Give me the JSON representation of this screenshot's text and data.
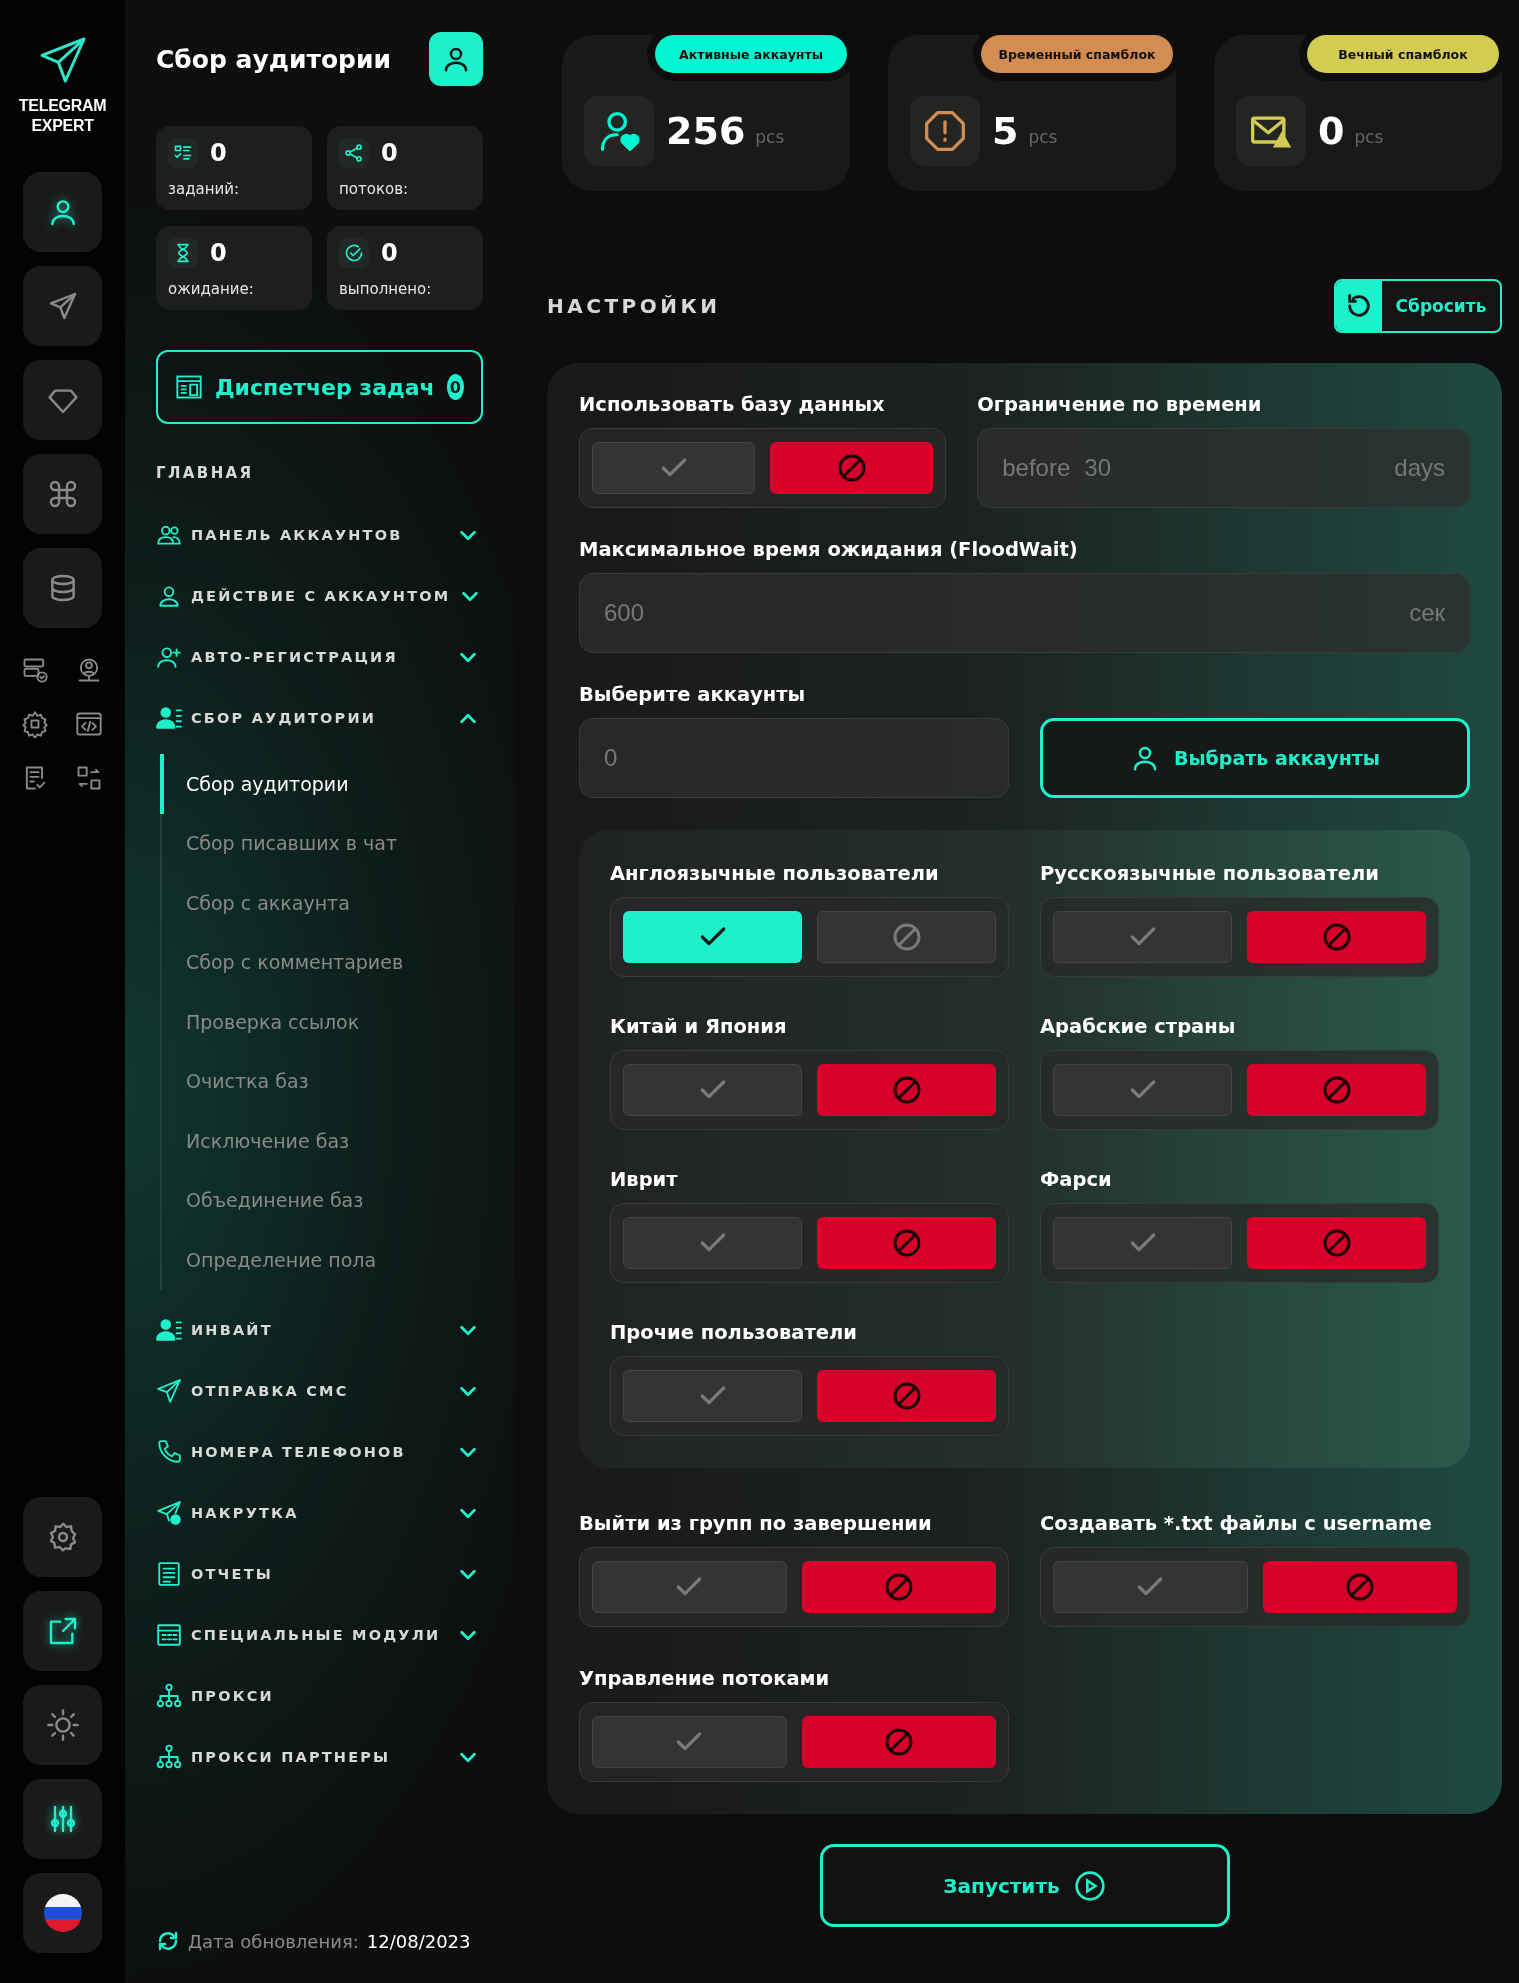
{
  "rail": {
    "logo": [
      "TELEGRAM",
      "EXPERT"
    ],
    "top_buttons": [
      {
        "selected": true
      },
      {
        "selected": false
      },
      {
        "selected": false
      },
      {
        "selected": false
      },
      {
        "selected": false
      }
    ],
    "bottom_buttons": [
      {
        "highlighted": false
      },
      {
        "highlighted": true
      },
      {
        "highlighted": false
      },
      {
        "highlighted": true
      }
    ]
  },
  "sidebar": {
    "title": "Сбор аудитории",
    "stats": [
      {
        "value": "0",
        "label": "заданий:"
      },
      {
        "value": "0",
        "label": "потоков:"
      },
      {
        "value": "0",
        "label": "ожидание:"
      },
      {
        "value": "0",
        "label": "выполнено:"
      }
    ],
    "task_manager": {
      "label": "Диспетчер задач",
      "count": "0"
    },
    "section": "ГЛАВНАЯ",
    "menu": [
      {
        "label": "ПАНЕЛЬ АККАУНТОВ",
        "kind": "group",
        "expanded": false
      },
      {
        "label": "ДЕЙСТВИЕ С АККАУНТОМ",
        "kind": "group",
        "expanded": false
      },
      {
        "label": "АВТО-РЕГИСТРАЦИЯ",
        "kind": "group",
        "expanded": false
      },
      {
        "label": "СБОР АУДИТОРИИ",
        "kind": "group",
        "expanded": true,
        "children": [
          {
            "label": "Сбор аудитории",
            "selected": true
          },
          {
            "label": "Сбор писавших в чат",
            "selected": false
          },
          {
            "label": "Сбор с аккаунта",
            "selected": false
          },
          {
            "label": "Сбор с комментариев",
            "selected": false
          },
          {
            "label": "Проверка ссылок",
            "selected": false
          },
          {
            "label": "Очистка баз",
            "selected": false
          },
          {
            "label": "Исключение баз",
            "selected": false
          },
          {
            "label": "Объединение баз",
            "selected": false
          },
          {
            "label": "Определение пола",
            "selected": false
          }
        ]
      },
      {
        "label": "ИНВАЙТ",
        "kind": "group",
        "expanded": false
      },
      {
        "label": "ОТПРАВКА СМС",
        "kind": "group",
        "expanded": false
      },
      {
        "label": "НОМЕРА ТЕЛЕФОНОВ",
        "kind": "group",
        "expanded": false
      },
      {
        "label": "НАКРУТКА",
        "kind": "group",
        "expanded": false
      },
      {
        "label": "ОТЧЕТЫ",
        "kind": "group",
        "expanded": false
      },
      {
        "label": "СПЕЦИАЛЬНЫЕ МОДУЛИ",
        "kind": "group",
        "expanded": false
      },
      {
        "label": "ПРОКСИ",
        "kind": "link"
      },
      {
        "label": "ПРОКСИ ПАРТНЕРЫ",
        "kind": "group",
        "expanded": false
      }
    ],
    "footer": {
      "label": "Дата обновления:",
      "date": "12/08/2023"
    }
  },
  "stats": [
    {
      "badge": "Активные аккаунты",
      "value": "256",
      "unit": "pcs",
      "color": "#00f5d0"
    },
    {
      "badge": "Временный спамблок",
      "value": "5",
      "unit": "pcs",
      "color": "#d38c52"
    },
    {
      "badge": "Вечный спамблок",
      "value": "0",
      "unit": "pcs",
      "color": "#d3cc52"
    }
  ],
  "settings": {
    "title": "НАСТРОЙКИ",
    "reset": "Сбросить",
    "use_database": {
      "label": "Использовать базу данных",
      "enabled": false
    },
    "time_limit": {
      "label": "Ограничение по времени",
      "prefix": "before",
      "placeholder": "30",
      "unit": "days"
    },
    "flood_wait": {
      "label": "Максимальное время ожидания (FloodWait)",
      "placeholder": "600",
      "unit": "сек"
    },
    "accounts": {
      "label": "Выберите аккаунты",
      "placeholder": "0",
      "button": "Выбрать аккаунты"
    },
    "languages": [
      {
        "label": "Англоязычные пользователи",
        "enabled": true
      },
      {
        "label": "Русскоязычные пользователи",
        "enabled": false
      },
      {
        "label": "Китай и Япония",
        "enabled": false
      },
      {
        "label": "Арабские страны",
        "enabled": false
      },
      {
        "label": "Иврит",
        "enabled": false
      },
      {
        "label": "Фарси",
        "enabled": false
      },
      {
        "label": "Прочие пользователи",
        "enabled": false
      }
    ],
    "options": [
      {
        "label": "Выйти из групп по завершении",
        "enabled": false
      },
      {
        "label": "Создавать *.txt файлы с username",
        "enabled": false
      },
      {
        "label": "Управление потоками",
        "enabled": false
      }
    ],
    "start": "Запустить"
  }
}
